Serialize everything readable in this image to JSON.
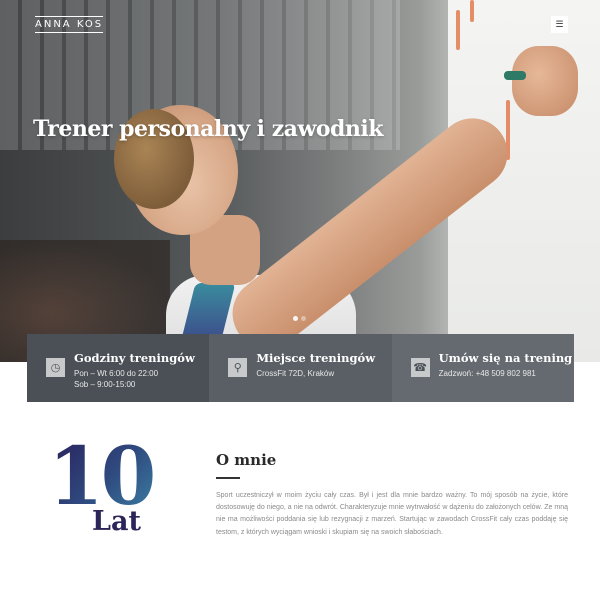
{
  "header": {
    "logo": "ANNA KOS",
    "menu_icon": "hamburger-icon"
  },
  "hero": {
    "title": "Trener personalny i zawodnik",
    "slides": 2,
    "active_slide": 1
  },
  "info": [
    {
      "icon": "clock-icon",
      "title": "Godziny treningów",
      "lines": [
        "Pon – Wt 6:00 do 22:00",
        "Sob – 9:00-15:00"
      ]
    },
    {
      "icon": "map-pin-icon",
      "title": "Miejsce treningów",
      "lines": [
        "CrossFit 72D, Kraków"
      ]
    },
    {
      "icon": "phone-icon",
      "title": "Umów się na trening",
      "lines": [
        "Zadzwoń: +48 509 802 981"
      ]
    }
  ],
  "about": {
    "years_number": "10",
    "years_label": "Lat",
    "title": "O mnie",
    "text": "Sport uczestniczył w moim życiu cały czas. Był i jest dla mnie bardzo ważny. To mój sposób na życie, które dostosowuję do niego, a nie na odwrót. Charakteryzuje mnie wytrwałość w dążeniu do założonych celów. Ze mną nie ma możliwości poddania się lub rezygnacji z marzeń. Startując w zawodach CrossFit cały czas poddaję się testom, z których wyciągam wnioski i skupiam się na swoich słabościach."
  },
  "colors": {
    "info_bg_1": "#4a5056",
    "info_bg_2": "#5a5f65",
    "info_bg_3": "#656a70",
    "accent_dark": "#2c2559"
  }
}
